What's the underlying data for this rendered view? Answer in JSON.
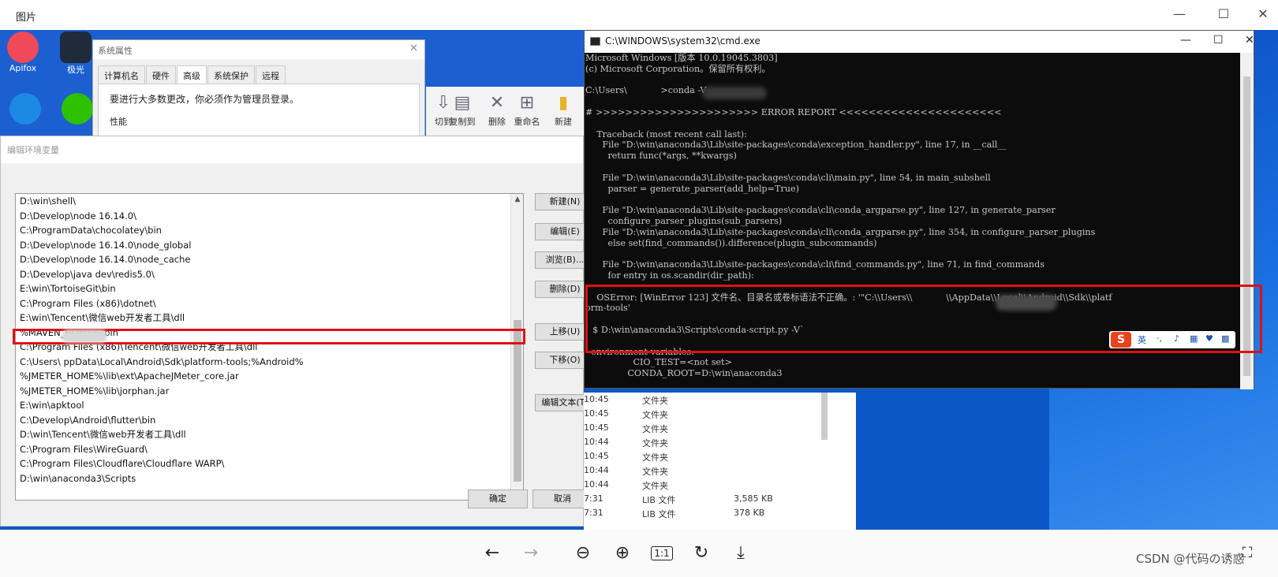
{
  "viewer": {
    "title": "图片",
    "controls": [
      "minimize-icon",
      "maximize-icon",
      "close-icon"
    ],
    "watermark": "CSDN @代码の诱惑"
  },
  "desktop": {
    "icons": [
      {
        "label": "Apifox"
      },
      {
        "label": "极光"
      }
    ]
  },
  "sysprops": {
    "title": "系统属性",
    "tabs": [
      "计算机名",
      "硬件",
      "高级",
      "系统保护",
      "远程"
    ],
    "active_tab": "高级",
    "message": "要进行大多数更改，你必须作为管理员登录。",
    "section": "性能"
  },
  "explorer_toolbar": {
    "buttons": [
      "切到",
      "复制到",
      "删除",
      "重命名",
      "新建"
    ]
  },
  "envdialog": {
    "title": "编辑环境变量",
    "paths": [
      "D:\\win\\shell\\",
      "D:\\Develop\\node 16.14.0\\",
      "C:\\ProgramData\\chocolatey\\bin",
      "D:\\Develop\\node 16.14.0\\node_global",
      "D:\\Develop\\node 16.14.0\\node_cache",
      "D:\\Develop\\java dev\\redis5.0\\",
      "E:\\win\\TortoiseGit\\bin",
      "C:\\Program Files (x86)\\dotnet\\",
      "E:\\win\\Tencent\\微信web开发者工具\\dll",
      "%MAVEN_HOME%\\bin",
      "C:\\Program Files (x86)\\Tencent\\微信web开发者工具\\dll",
      "C:\\Users\\            ppData\\Local\\Android\\Sdk\\platform-tools;%Android%",
      "%JMETER_HOME%\\lib\\ext\\ApacheJMeter_core.jar",
      "%JMETER_HOME%\\lib\\jorphan.jar",
      "E:\\win\\apktool",
      "C:\\Develop\\Android\\flutter\\bin",
      "D:\\win\\Tencent\\微信web开发者工具\\dll",
      "C:\\Program Files\\WireGuard\\",
      "C:\\Program Files\\Cloudflare\\Cloudflare WARP\\",
      "D:\\win\\anaconda3\\Scripts"
    ],
    "buttons": {
      "new": "新建(N)",
      "edit": "编辑(E)",
      "browse": "浏览(B)...",
      "delete": "删除(D)",
      "moveup": "上移(U)",
      "movedown": "下移(O)",
      "edittext": "编辑文本(T)",
      "ok": "确定",
      "cancel": "取消"
    }
  },
  "files": {
    "rows": [
      {
        "time": "10:45",
        "type": "文件夹",
        "size": ""
      },
      {
        "time": "10:45",
        "type": "文件夹",
        "size": ""
      },
      {
        "time": "10:45",
        "type": "文件夹",
        "size": ""
      },
      {
        "time": "10:44",
        "type": "文件夹",
        "size": ""
      },
      {
        "time": "10:45",
        "type": "文件夹",
        "size": ""
      },
      {
        "time": "10:44",
        "type": "文件夹",
        "size": ""
      },
      {
        "time": "10:44",
        "type": "文件夹",
        "size": ""
      },
      {
        "time": "7:31",
        "type": "LIB 文件",
        "size": "3,585 KB"
      },
      {
        "time": "7:31",
        "type": "LIB 文件",
        "size": "378 KB"
      }
    ]
  },
  "cmd": {
    "title": "C:\\WINDOWS\\system32\\cmd.exe",
    "lines": [
      "Microsoft Windows [版本 10.0.19045.3803]",
      "(c) Microsoft Corporation。保留所有权利。",
      "",
      "C:\\Users\\            >conda -V",
      "",
      "# >>>>>>>>>>>>>>>>>>>>>> ERROR REPORT <<<<<<<<<<<<<<<<<<<<<<",
      "",
      "    Traceback (most recent call last):",
      "      File \"D:\\win\\anaconda3\\Lib\\site-packages\\conda\\exception_handler.py\", line 17, in __call__",
      "        return func(*args, **kwargs)",
      "",
      "      File \"D:\\win\\anaconda3\\Lib\\site-packages\\conda\\cli\\main.py\", line 54, in main_subshell",
      "        parser = generate_parser(add_help=True)",
      "",
      "      File \"D:\\win\\anaconda3\\Lib\\site-packages\\conda\\cli\\conda_argparse.py\", line 127, in generate_parser",
      "        configure_parser_plugins(sub_parsers)",
      "      File \"D:\\win\\anaconda3\\Lib\\site-packages\\conda\\cli\\conda_argparse.py\", line 354, in configure_parser_plugins",
      "        else set(find_commands()).difference(plugin_subcommands)",
      "",
      "      File \"D:\\win\\anaconda3\\Lib\\site-packages\\conda\\cli\\find_commands.py\", line 71, in find_commands",
      "        for entry in os.scandir(dir_path):",
      "",
      "    OSError: [WinError 123] 文件名、目录名或卷标语法不正确。: '\"C:\\\\Users\\\\            \\\\AppData\\\\Local\\\\Android\\\\Sdk\\\\platf",
      "orm-tools'",
      "",
      "` $ D:\\win\\anaconda3\\Scripts\\conda-script.py -V`",
      "",
      "  environment variables:",
      "                 CIO_TEST=<not set>",
      "               CONDA_ROOT=D:\\win\\anaconda3"
    ]
  },
  "ime": {
    "logo": "S",
    "mode": "英"
  },
  "toolbar": {
    "buttons": [
      "back-icon",
      "forward-icon",
      "zoom-out-icon",
      "zoom-in-icon",
      "actual-size-icon",
      "rotate-icon",
      "download-icon",
      "fullscreen-icon"
    ],
    "actual_size_label": "1:1"
  }
}
